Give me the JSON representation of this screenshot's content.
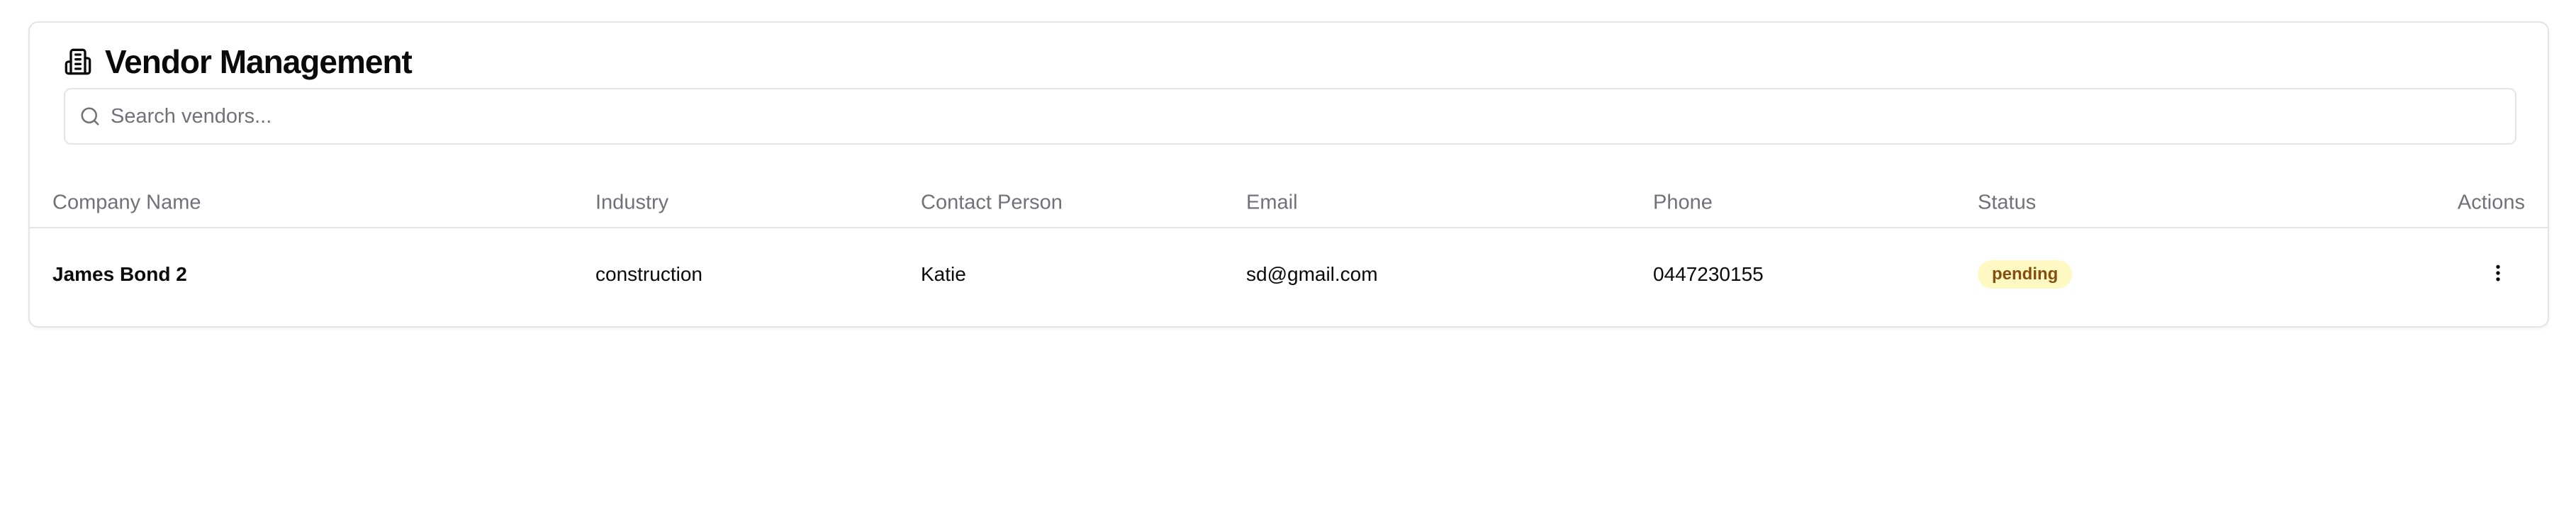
{
  "header": {
    "title": "Vendor Management",
    "icon": "building-icon"
  },
  "search": {
    "placeholder": "Search vendors...",
    "value": "",
    "icon": "search-icon"
  },
  "table": {
    "columns": [
      "Company Name",
      "Industry",
      "Contact Person",
      "Email",
      "Phone",
      "Status",
      "Actions"
    ],
    "rows": [
      {
        "company": "James Bond 2",
        "industry": "construction",
        "contact": "Katie",
        "email": "sd@gmail.com",
        "phone": "0447230155",
        "status": "pending",
        "actions_icon": "more-vertical-icon"
      }
    ]
  },
  "colors": {
    "border": "#e4e4e7",
    "muted_text": "#71717a",
    "pending_badge_bg": "#fef9c3",
    "pending_badge_text": "#854d0e"
  }
}
